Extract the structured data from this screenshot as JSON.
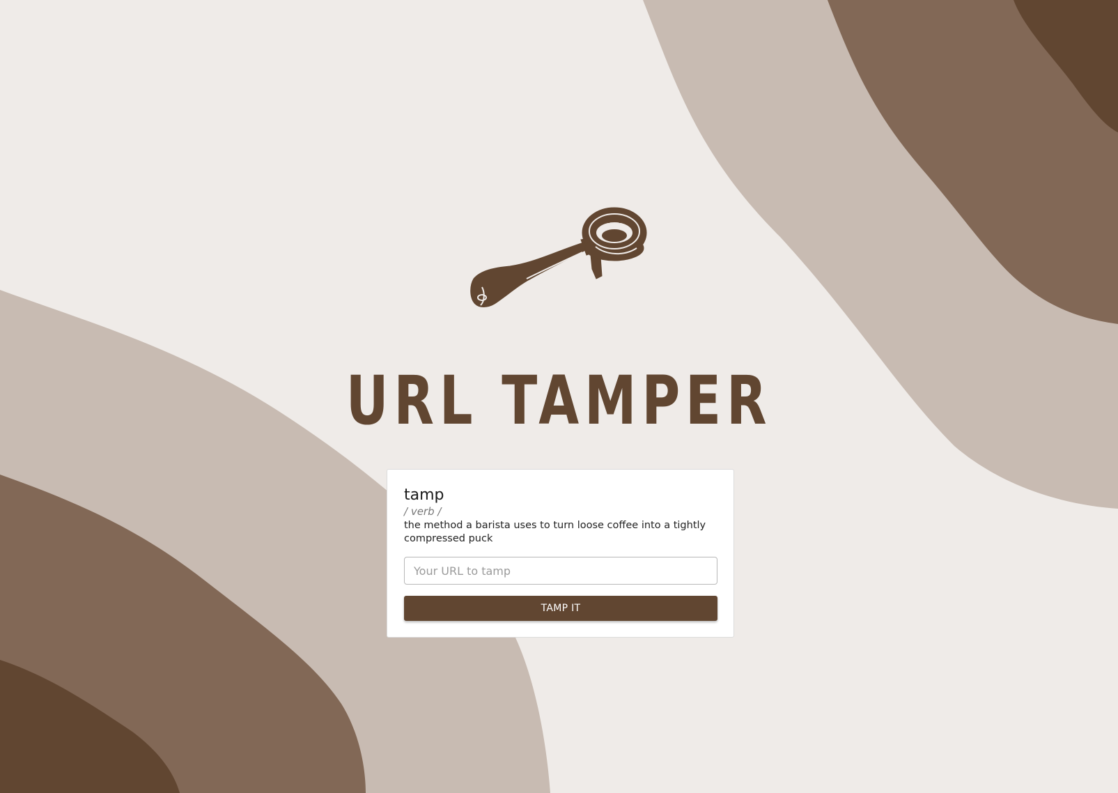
{
  "app": {
    "title": "URL TAMPER",
    "logo_icon": "portafilter-icon"
  },
  "definition": {
    "word": "tamp",
    "part_of_speech": "/ verb /",
    "text": "the method a barista uses to turn loose coffee into a tightly compressed puck"
  },
  "form": {
    "url_input": {
      "value": "",
      "placeholder": "Your URL to tamp"
    },
    "submit_label": "TAMP IT"
  },
  "colors": {
    "background": "#efebe8",
    "light_wave": "#c8bbb2",
    "mid_wave": "#826856",
    "dark_wave": "#614631",
    "accent": "#614631"
  }
}
